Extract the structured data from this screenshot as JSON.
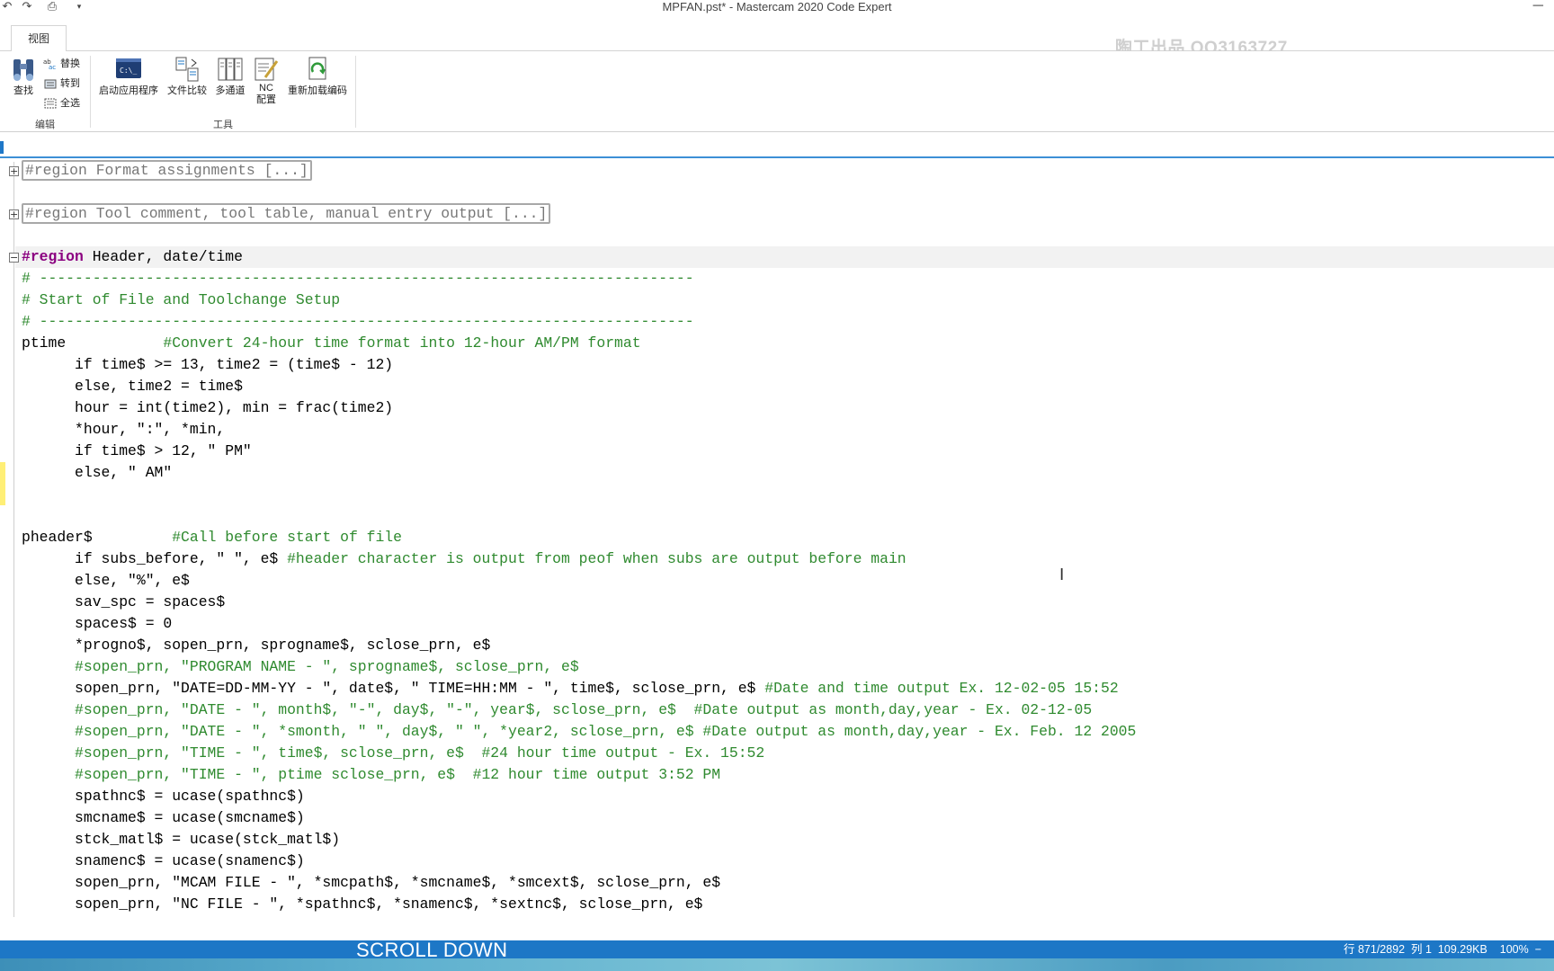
{
  "window": {
    "title": "MPFAN.pst* - Mastercam 2020 Code Expert",
    "minimize_glyph": "─"
  },
  "quick_access": [
    {
      "name": "undo-icon",
      "glyph": "↶"
    },
    {
      "name": "redo-icon",
      "glyph": "↷"
    },
    {
      "name": "print-icon",
      "glyph": "⎙"
    },
    {
      "name": "customize-icon",
      "glyph": "▾"
    }
  ],
  "ribbon": {
    "tab_label": "视图",
    "watermark": "陶工出品 QQ3163727",
    "edit_group": {
      "label": "编辑",
      "find_label": "查找",
      "replace_label": "替换",
      "goto_label": "转到",
      "select_all_label": "全选"
    },
    "tools_group": {
      "label": "工具",
      "launch_label": "启动应用程序",
      "compare_label": "文件比较",
      "multichannel_label": "多通道",
      "nc_config_label_1": "NC",
      "nc_config_label_2": "配置",
      "reload_label": "重新加载编码"
    }
  },
  "editor": {
    "lines": [
      {
        "segments": [
          {
            "t": "#region Format assignments [...]",
            "c": "collapsed"
          }
        ],
        "fold": "+"
      },
      {
        "segments": [
          {
            "t": "",
            "c": ""
          }
        ]
      },
      {
        "segments": [
          {
            "t": "#region Tool comment, tool table, manual entry output [...]",
            "c": "collapsed"
          }
        ],
        "fold": "+"
      },
      {
        "segments": [
          {
            "t": "",
            "c": ""
          }
        ]
      },
      {
        "segments": [
          {
            "t": "#region",
            "c": "kw"
          },
          {
            "t": " Header, date/time",
            "c": ""
          }
        ],
        "fold": "−"
      },
      {
        "segments": [
          {
            "t": "# --------------------------------------------------------------------------",
            "c": "cm"
          }
        ]
      },
      {
        "segments": [
          {
            "t": "# Start of File and Toolchange Setup",
            "c": "cm"
          }
        ]
      },
      {
        "segments": [
          {
            "t": "# --------------------------------------------------------------------------",
            "c": "cm"
          }
        ]
      },
      {
        "segments": [
          {
            "t": "ptime           ",
            "c": ""
          },
          {
            "t": "#Convert 24-hour time format into 12-hour AM/PM format",
            "c": "cm"
          }
        ]
      },
      {
        "segments": [
          {
            "t": "      if time$ >= 13, time2 = (time$ - 12)",
            "c": ""
          }
        ]
      },
      {
        "segments": [
          {
            "t": "      else, time2 = time$",
            "c": ""
          }
        ]
      },
      {
        "segments": [
          {
            "t": "      hour = int(time2), min = frac(time2)",
            "c": ""
          }
        ]
      },
      {
        "segments": [
          {
            "t": "      *hour, \":\", *min,",
            "c": ""
          }
        ]
      },
      {
        "segments": [
          {
            "t": "      if time$ > 12, \" PM\"",
            "c": ""
          }
        ]
      },
      {
        "segments": [
          {
            "t": "      else, \" AM\"",
            "c": ""
          }
        ]
      },
      {
        "segments": [
          {
            "t": "",
            "c": ""
          }
        ]
      },
      {
        "segments": [
          {
            "t": "",
            "c": ""
          }
        ]
      },
      {
        "segments": [
          {
            "t": "pheader$         ",
            "c": ""
          },
          {
            "t": "#Call before start of file",
            "c": "cm"
          }
        ]
      },
      {
        "segments": [
          {
            "t": "      if subs_before, \" \", e$ ",
            "c": ""
          },
          {
            "t": "#header character is output from peof when subs are output before main",
            "c": "cm"
          }
        ]
      },
      {
        "segments": [
          {
            "t": "      else, \"%\", e$",
            "c": ""
          }
        ]
      },
      {
        "segments": [
          {
            "t": "      sav_spc = spaces$",
            "c": ""
          }
        ]
      },
      {
        "segments": [
          {
            "t": "      spaces$ = 0",
            "c": ""
          }
        ]
      },
      {
        "segments": [
          {
            "t": "      *progno$, sopen_prn, sprogname$, sclose_prn, e$",
            "c": ""
          }
        ]
      },
      {
        "segments": [
          {
            "t": "      #sopen_prn, \"PROGRAM NAME - \", sprogname$, sclose_prn, e$",
            "c": "cm"
          }
        ]
      },
      {
        "segments": [
          {
            "t": "      sopen_prn, \"DATE=DD-MM-YY - \", date$, \" TIME=HH:MM - \", time$, sclose_prn, e$ ",
            "c": ""
          },
          {
            "t": "#Date and time output Ex. 12-02-05 15:52",
            "c": "cm"
          }
        ]
      },
      {
        "segments": [
          {
            "t": "      #sopen_prn, \"DATE - \", month$, \"-\", day$, \"-\", year$, sclose_prn, e$  #Date output as month,day,year - Ex. 02-12-05",
            "c": "cm"
          }
        ]
      },
      {
        "segments": [
          {
            "t": "      #sopen_prn, \"DATE - \", *smonth, \" \", day$, \" \", *year2, sclose_prn, e$ #Date output as month,day,year - Ex. Feb. 12 2005",
            "c": "cm"
          }
        ]
      },
      {
        "segments": [
          {
            "t": "      #sopen_prn, \"TIME - \", time$, sclose_prn, e$  #24 hour time output - Ex. 15:52",
            "c": "cm"
          }
        ]
      },
      {
        "segments": [
          {
            "t": "      #sopen_prn, \"TIME - \", ptime sclose_prn, e$  #12 hour time output 3:52 PM",
            "c": "cm"
          }
        ]
      },
      {
        "segments": [
          {
            "t": "      spathnc$ = ucase(spathnc$)",
            "c": ""
          }
        ]
      },
      {
        "segments": [
          {
            "t": "      smcname$ = ucase(smcname$)",
            "c": ""
          }
        ]
      },
      {
        "segments": [
          {
            "t": "      stck_matl$ = ucase(stck_matl$)",
            "c": ""
          }
        ]
      },
      {
        "segments": [
          {
            "t": "      snamenc$ = ucase(snamenc$)",
            "c": ""
          }
        ]
      },
      {
        "segments": [
          {
            "t": "      sopen_prn, \"MCAM FILE - \", *smcpath$, *smcname$, *smcext$, sclose_prn, e$",
            "c": ""
          }
        ]
      },
      {
        "segments": [
          {
            "t": "      sopen_prn, \"NC FILE - \", *spathnc$, *snamenc$, *sextnc$, sclose_prn, e$",
            "c": ""
          }
        ]
      }
    ]
  },
  "status": {
    "line_col": "行 871/2892  列 1  109.29KB",
    "zoom": "100%",
    "zoom_glyph": "−",
    "caption": "SCROLL DOWN",
    "bar_color": "#1d77c6"
  }
}
